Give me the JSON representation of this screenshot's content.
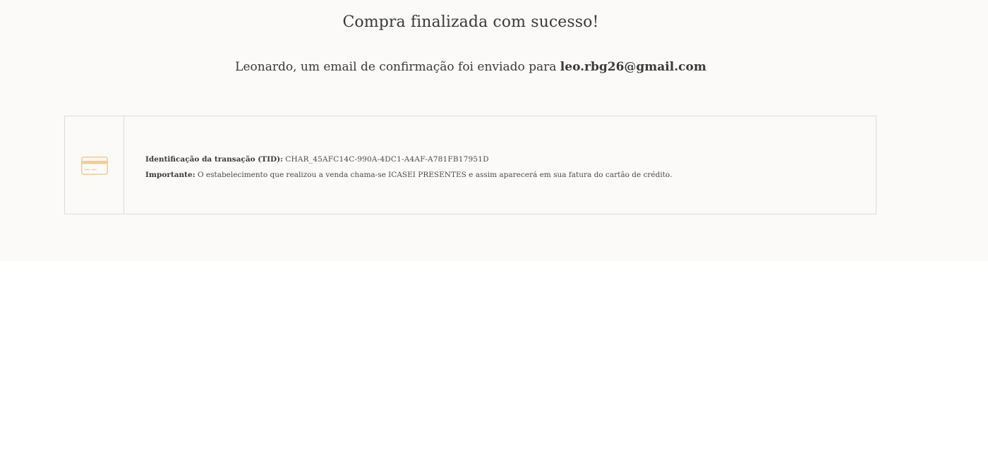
{
  "confirmation": {
    "title": "Compra finalizada com sucesso!",
    "message_prefix": "Leonardo, um email de confirmação foi enviado para ",
    "email": "leo.rbg26@gmail.com"
  },
  "payment": {
    "icon": "credit-card-icon",
    "icon_color": "#f2cd94",
    "tid_label": "Identificação da transação (TID):",
    "tid_value": "CHAR_45AFC14C-990A-4DC1-A4AF-A781FB17951D",
    "important_label": "Importante:",
    "important_text": "O estabelecimento que realizou a venda chama-se ICASEI PRESENTES e assim aparecerá em sua fatura do cartão de crédito."
  }
}
